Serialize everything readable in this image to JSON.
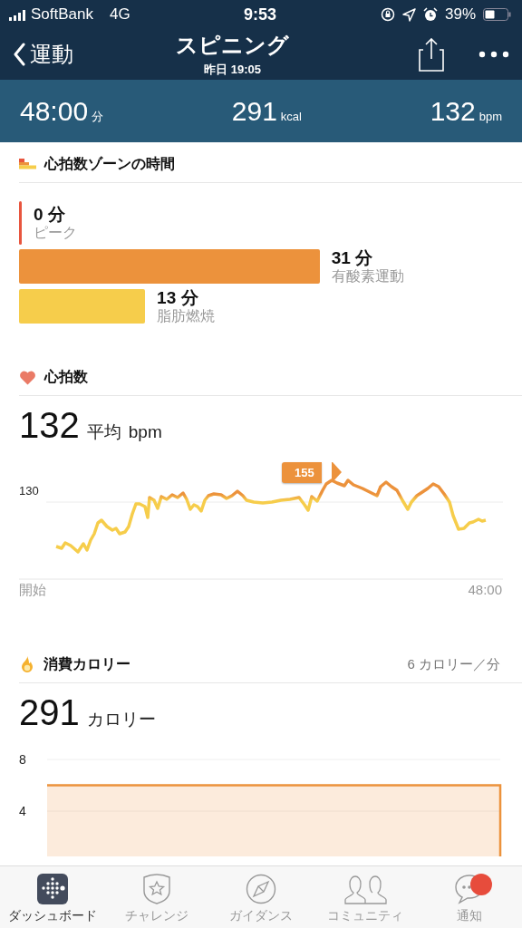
{
  "status_bar": {
    "carrier": "SoftBank",
    "network": "4G",
    "time": "9:53",
    "battery": "39%"
  },
  "nav": {
    "back": "運動",
    "title": "スピニング",
    "subtitle": "昨日 19:05"
  },
  "summary": [
    {
      "value": "48:00",
      "unit": "分"
    },
    {
      "value": "291",
      "unit": "kcal"
    },
    {
      "value": "132",
      "unit": "bpm"
    }
  ],
  "zones": {
    "title": "心拍数ゾーンの時間",
    "items": [
      {
        "minutes": "0 分",
        "label": "ピーク",
        "color": "#e8553e"
      },
      {
        "minutes": "31 分",
        "label": "有酸素運動",
        "color": "#ec923c"
      },
      {
        "minutes": "13 分",
        "label": "脂肪燃焼",
        "color": "#f6cd4b"
      }
    ]
  },
  "heart_rate": {
    "title": "心拍数",
    "value": "132",
    "average": "平均",
    "unit": "bpm",
    "peak": "155",
    "y_tick": "130",
    "x_start": "開始",
    "x_end": "48:00"
  },
  "calories": {
    "title": "消費カロリー",
    "rate": "6 カロリー／分",
    "value": "291",
    "unit": "カロリー",
    "chart_data": {
      "type": "area",
      "categories": [
        null,
        null,
        null,
        null,
        null,
        null,
        null,
        null,
        null,
        null,
        null,
        null,
        null,
        null,
        null,
        null,
        null,
        null,
        null,
        null,
        null,
        null,
        null,
        null,
        null,
        null,
        null,
        null,
        null,
        null,
        null,
        null,
        null,
        null,
        null,
        null,
        null,
        null,
        null,
        null,
        null,
        null,
        null,
        null,
        null,
        null,
        null,
        null,
        null
      ],
      "series": [
        {
          "color": "#ec923c",
          "values": [
            6,
            6,
            6,
            6,
            6,
            6,
            6,
            6,
            6,
            6,
            6,
            6,
            6,
            6,
            6,
            6,
            6,
            6,
            6,
            6,
            6,
            6,
            6,
            6,
            6,
            6,
            6,
            6,
            6,
            6,
            6,
            6,
            6,
            6,
            6,
            6,
            6,
            6,
            6,
            6,
            6,
            6,
            6,
            6,
            6,
            6,
            6,
            6,
            6
          ]
        }
      ],
      "ylim": [
        0,
        8
      ],
      "yticks": [
        4,
        8
      ]
    }
  },
  "tabs": [
    {
      "label": "ダッシュボード",
      "selected": true
    },
    {
      "label": "チャレンジ",
      "selected": false
    },
    {
      "label": "ガイダンス",
      "selected": false
    },
    {
      "label": "コミュニティ",
      "selected": false
    },
    {
      "label": "通知",
      "selected": false,
      "badge": true
    }
  ]
}
